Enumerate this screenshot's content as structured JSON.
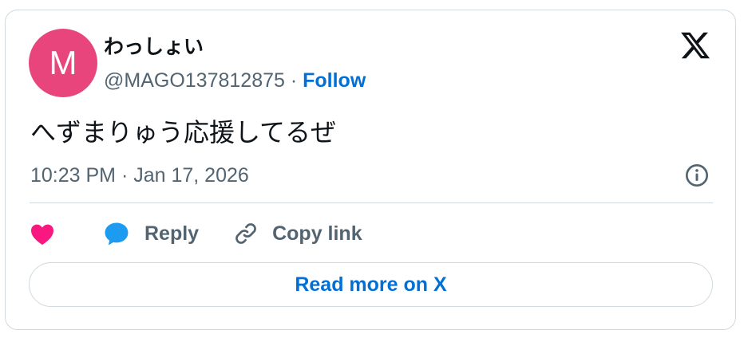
{
  "author": {
    "avatar_initial": "M",
    "avatar_color": "#e8457d",
    "display_name": "わっしょい",
    "handle": "@MAGO137812875",
    "separator": " · ",
    "follow_label": "Follow"
  },
  "tweet": {
    "text": "へずまりゅう応援してるぜ",
    "timestamp": "10:23 PM · Jan 17, 2026"
  },
  "actions": {
    "like_icon": "heart-icon",
    "reply_label": "Reply",
    "reply_icon": "speech-bubble-icon",
    "copy_label": "Copy link",
    "copy_icon": "link-icon"
  },
  "read_more_label": "Read more on X",
  "colors": {
    "like": "#f91880",
    "reply": "#1d9bf0",
    "link": "#006fd6",
    "secondary_text": "#536471",
    "border": "#cfd9de"
  },
  "icons": {
    "brand": "x-logo-icon",
    "info": "info-icon"
  }
}
